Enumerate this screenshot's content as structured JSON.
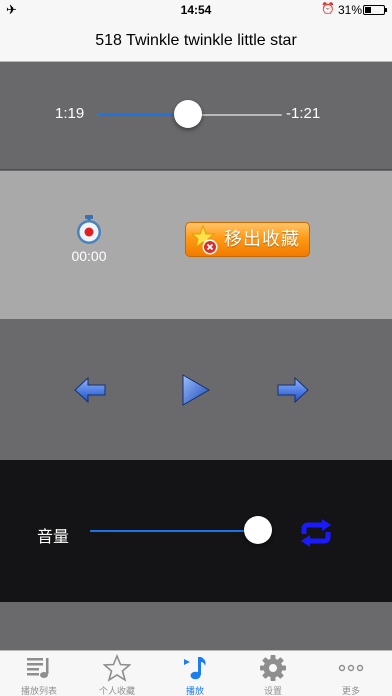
{
  "status_bar": {
    "time": "14:54",
    "battery_percent": "31%",
    "battery_level": 0.31,
    "airplane_icon": "airplane-icon",
    "alarm_icon": "alarm-icon"
  },
  "header": {
    "title": "518 Twinkle twinkle little star"
  },
  "progress": {
    "elapsed": "1:19",
    "remaining": "-1:21",
    "position_fraction": 0.49
  },
  "actions": {
    "timer_value": "00:00",
    "unfavorite_label": "移出收藏",
    "timer_icon": "stopwatch-icon",
    "unfavorite_icon": "star-remove-icon"
  },
  "controls": {
    "previous_icon": "arrow-left-icon",
    "play_icon": "play-icon",
    "next_icon": "arrow-right-icon"
  },
  "volume": {
    "label": "音量",
    "level_fraction": 1.0,
    "repeat_icon": "repeat-icon"
  },
  "colors": {
    "accent": "#1a7ef0",
    "slider_fill": "#1a73e8",
    "unfavorite_orange": "#ff9a16",
    "repeat_blue": "#1a1aff"
  },
  "tabs": [
    {
      "label": "播放列表",
      "icon": "playlist-icon",
      "active": false
    },
    {
      "label": "个人收藏",
      "icon": "star-icon",
      "active": false
    },
    {
      "label": "播放",
      "icon": "music-note-icon",
      "active": true
    },
    {
      "label": "设置",
      "icon": "gear-icon",
      "active": false
    },
    {
      "label": "更多",
      "icon": "more-icon",
      "active": false
    }
  ]
}
